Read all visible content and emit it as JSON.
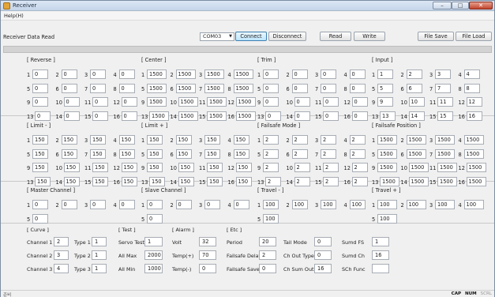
{
  "window": {
    "title": "Receiver",
    "minimize": "–",
    "maximize": "□",
    "close": "✕"
  },
  "menu": {
    "help": "Help(H)"
  },
  "toolbar": {
    "label": "Receiver Data Read",
    "port": "COM03",
    "connect": "Connect",
    "disconnect": "Disconnect",
    "read": "Read",
    "write": "Write",
    "file_save": "File Save",
    "file_load": "File Load"
  },
  "progress": 0,
  "groups": {
    "reverse": {
      "title": "[ Reverse ]",
      "values": [
        "0",
        "0",
        "0",
        "0",
        "0",
        "0",
        "0",
        "0",
        "0",
        "0",
        "0",
        "0",
        "0",
        "0",
        "0",
        "0"
      ]
    },
    "center": {
      "title": "[ Center ]",
      "values": [
        "1500",
        "1500",
        "1500",
        "1500",
        "1500",
        "1500",
        "1500",
        "1500",
        "1500",
        "1500",
        "1500",
        "1500",
        "1500",
        "1500",
        "1500",
        "1500"
      ]
    },
    "trim": {
      "title": "[ Trim ]",
      "values": [
        "0",
        "0",
        "0",
        "0",
        "0",
        "0",
        "0",
        "0",
        "0",
        "0",
        "0",
        "0",
        "0",
        "0",
        "0",
        "0"
      ]
    },
    "input": {
      "title": "[ Input ]",
      "values": [
        "1",
        "2",
        "3",
        "4",
        "5",
        "6",
        "7",
        "8",
        "9",
        "10",
        "11",
        "12",
        "13",
        "14",
        "15",
        "16"
      ]
    },
    "limit_minus": {
      "title": "[ Limit - ]",
      "values": [
        "150",
        "150",
        "150",
        "150",
        "150",
        "150",
        "150",
        "150",
        "150",
        "150",
        "150",
        "150",
        "150",
        "150",
        "150",
        "150"
      ]
    },
    "limit_plus": {
      "title": "[ Limit + ]",
      "values": [
        "150",
        "150",
        "150",
        "150",
        "150",
        "150",
        "150",
        "150",
        "150",
        "150",
        "150",
        "150",
        "150",
        "150",
        "150",
        "150"
      ]
    },
    "failsafe_mode": {
      "title": "[ Failsafe Mode ]",
      "values": [
        "2",
        "2",
        "2",
        "2",
        "2",
        "2",
        "2",
        "2",
        "2",
        "2",
        "2",
        "2",
        "2",
        "2",
        "2",
        "2"
      ]
    },
    "failsafe_position": {
      "title": "[ Failsafe Position ]",
      "values": [
        "1500",
        "1500",
        "1500",
        "1500",
        "1500",
        "1500",
        "1500",
        "1500",
        "1500",
        "1500",
        "1500",
        "1500",
        "1500",
        "1500",
        "1500",
        "1500"
      ]
    },
    "master_channel": {
      "title": "[ Master Channel ]",
      "values": [
        "0",
        "0",
        "0",
        "0",
        "0"
      ]
    },
    "slave_channel": {
      "title": "[ Slave Channel ]",
      "values": [
        "0",
        "0",
        "0",
        "0",
        "0"
      ]
    },
    "travel_minus": {
      "title": "[ Travel - ]",
      "values": [
        "100",
        "100",
        "100",
        "100",
        "100"
      ]
    },
    "travel_plus": {
      "title": "[ Travel + ]",
      "values": [
        "100",
        "100",
        "100",
        "100",
        "100"
      ]
    }
  },
  "curve": {
    "title": "[ Curve ]",
    "rows": [
      {
        "channel_label": "Channel 1",
        "channel": "2",
        "type_label": "Type 1",
        "type": "1"
      },
      {
        "channel_label": "Channel 2",
        "channel": "3",
        "type_label": "Type 2",
        "type": "1"
      },
      {
        "channel_label": "Channel 3",
        "channel": "4",
        "type_label": "Type 3",
        "type": "1"
      }
    ]
  },
  "test": {
    "title": "[ Test ]",
    "rows": [
      {
        "label": "Servo Test",
        "value": "1"
      },
      {
        "label": "All Max",
        "value": "2000"
      },
      {
        "label": "All Min",
        "value": "1000"
      }
    ]
  },
  "alarm": {
    "title": "[ Alarm ]",
    "rows": [
      {
        "label": "Volt",
        "value": "32"
      },
      {
        "label": "Temp(+)",
        "value": "70"
      },
      {
        "label": "Temp(-)",
        "value": "0"
      }
    ]
  },
  "etc": {
    "title": "[ Etc ]",
    "col1": [
      {
        "label": "Period",
        "value": "20"
      },
      {
        "label": "Failsafe Delay",
        "value": "2"
      },
      {
        "label": "Failsafe Save",
        "value": "0"
      }
    ],
    "col2": [
      {
        "label": "Tail Mode",
        "value": "0"
      },
      {
        "label": "Ch Out Type",
        "value": "0"
      },
      {
        "label": "Ch Sum Out",
        "value": "16"
      }
    ],
    "col3": [
      {
        "label": "Sumd FS",
        "value": "1"
      },
      {
        "label": "Sumd Ch",
        "value": "16"
      },
      {
        "label": "SCh Func",
        "value": ""
      }
    ]
  },
  "status": {
    "left": "준비",
    "cap": "CAP",
    "num": "NUM",
    "scrl": "SCRL"
  }
}
